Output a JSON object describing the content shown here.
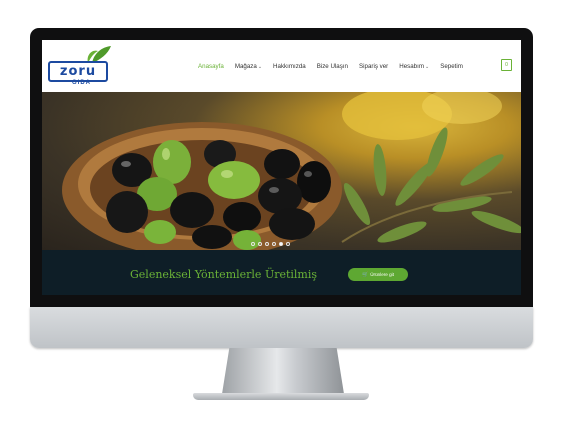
{
  "logo": {
    "word": "zoru",
    "subtitle": "GIDA"
  },
  "nav": {
    "items": [
      {
        "label": "Anasayfa",
        "active": true,
        "dropdown": false
      },
      {
        "label": "Mağaza",
        "active": false,
        "dropdown": true
      },
      {
        "label": "Hakkımızda",
        "active": false,
        "dropdown": false
      },
      {
        "label": "Bize Ulaşın",
        "active": false,
        "dropdown": false
      },
      {
        "label": "Sipariş ver",
        "active": false,
        "dropdown": false
      },
      {
        "label": "Hesabım",
        "active": false,
        "dropdown": true
      },
      {
        "label": "Sepetim",
        "active": false,
        "dropdown": false
      }
    ],
    "cart_count": "0",
    "cart_icon": "shopping-bag-icon"
  },
  "hero": {
    "slide_count": 6,
    "active_slide": 4
  },
  "banner": {
    "title": "Geleneksel Yöntemlerle Üretilmiş",
    "cta_label": "Ürünlere git",
    "cta_icon": "cart-icon"
  },
  "colors": {
    "accent": "#6ab237",
    "brand_blue": "#1c4aa0",
    "banner_bg": "#0e1e27",
    "bezel": "#0f0f10"
  }
}
